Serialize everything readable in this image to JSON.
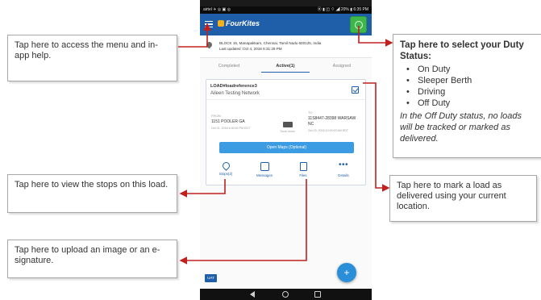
{
  "phone": {
    "status_left": "airtel ✈ ◎ ▣ ◎",
    "status_right": "⦿ ▮ ◫ ⌔ ◢ 20% ▮ 6:35 PM",
    "app_name": "FourKites",
    "location_line1": "BLOCK 16, Manapakkam, Chennai, Tamil Nadu 600125, India",
    "location_line2": "Last updated :Oct 4, 2018 6:31:29 PM",
    "tabs": [
      {
        "label": "Completed"
      },
      {
        "label": "Active(1)"
      },
      {
        "label": "Assigned"
      }
    ],
    "load": {
      "id": "LOAD#loadreference3",
      "network": "Aileen Testing Network",
      "from_label": "FROM",
      "from_address": "1151 POOLER GA",
      "from_date": "Oct 01, 2018 6:30:00 PM EDT",
      "truck_label": "Truck xxxxx",
      "to_label": "TO",
      "to_address_line1": "11S8447-28398 WARSAW",
      "to_address_line2": "NC",
      "to_date": "Oct 15, 2018 10:00:00 AM EDT",
      "open_maps": "Open Maps (Optional)",
      "actions": [
        {
          "label": "Stops(2)"
        },
        {
          "label": "Messages"
        },
        {
          "label": "Files"
        },
        {
          "label": "Details"
        }
      ]
    },
    "uat_badge": "UAT",
    "fab": "+"
  },
  "callouts": {
    "menu": "Tap here to access the menu and in-app help.",
    "stops": "Tap here to view the stops on this load.",
    "upload": "Tap here to upload an image or an e-signature.",
    "mark": "Tap here to mark a load as delivered using your current location.",
    "duty_title": "Tap here to select your Duty Status:",
    "duty_options": [
      "On Duty",
      "Sleeper Berth",
      "Driving",
      "Off Duty"
    ],
    "duty_note": "In the Off Duty status, no loads will be tracked or marked as delivered."
  },
  "colors": {
    "appbar": "#1f5faa",
    "duty_button": "#3fb64b",
    "arrow": "#c0201e"
  }
}
